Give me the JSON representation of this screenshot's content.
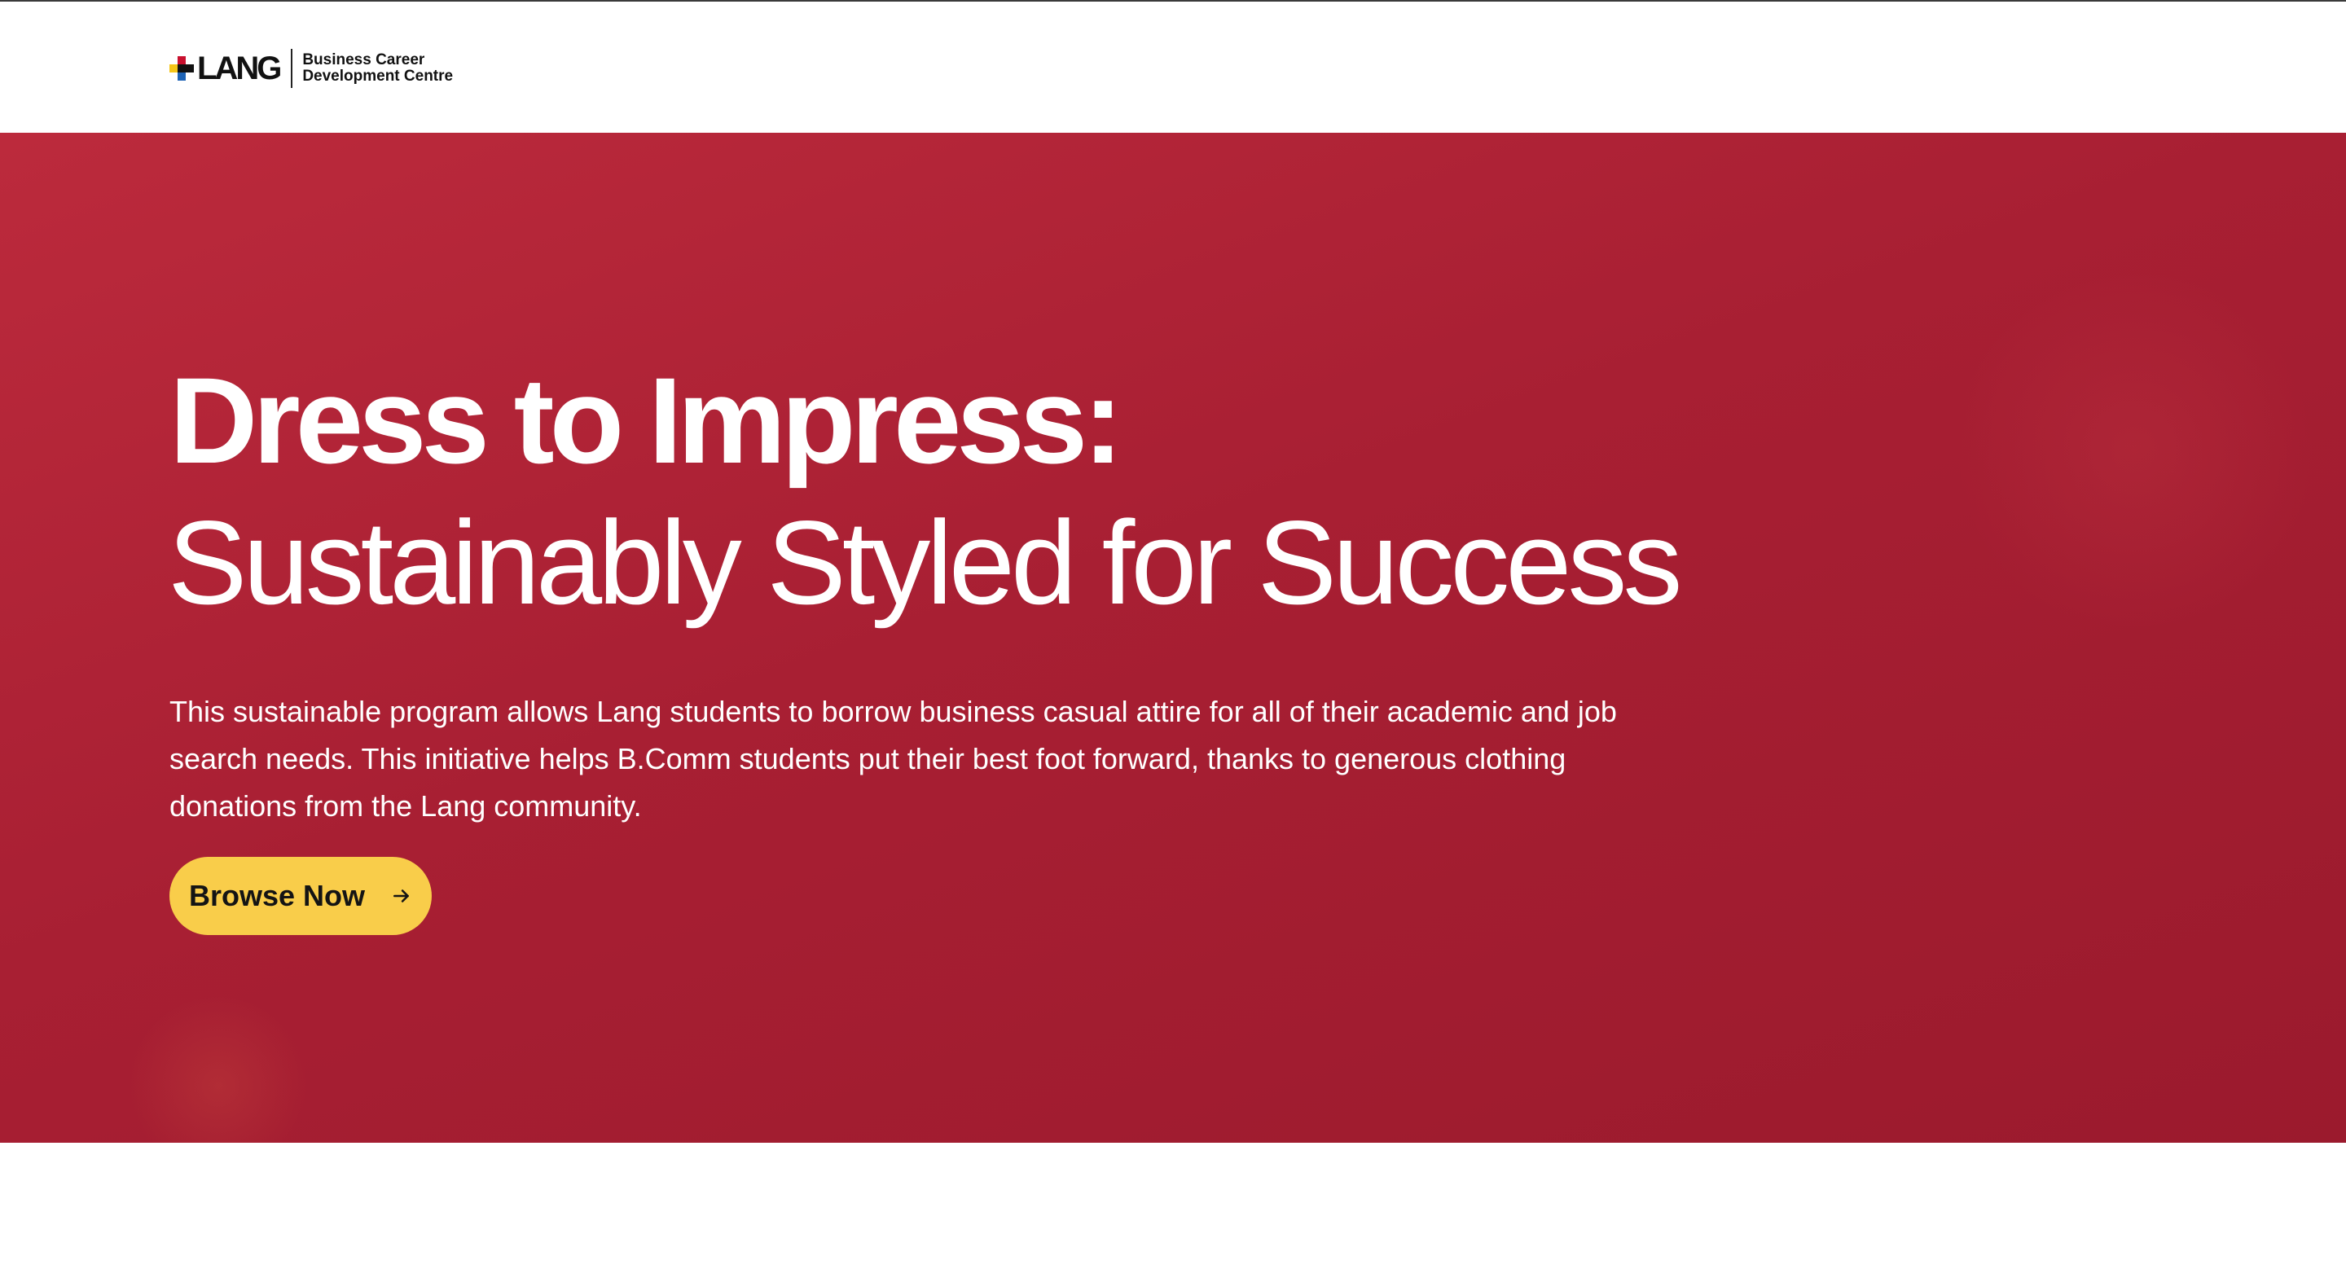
{
  "header": {
    "logo_text": "LANG",
    "logo_subtitle_line1": "Business Career",
    "logo_subtitle_line2": "Development Centre"
  },
  "hero": {
    "title": "Dress to Impress:",
    "subtitle": "Sustainably Styled for Success",
    "description": "This sustainable program allows Lang students to borrow business casual attire for all of their academic and job search needs. This initiative helps B.Comm students put their best foot forward, thanks to generous clothing donations from the Lang community.",
    "cta_label": "Browse Now",
    "cta_icon": "arrow-right-icon"
  },
  "colors": {
    "hero_background": "#a81f33",
    "cta_background": "#f9cd4a",
    "text_on_hero": "#ffffff"
  }
}
